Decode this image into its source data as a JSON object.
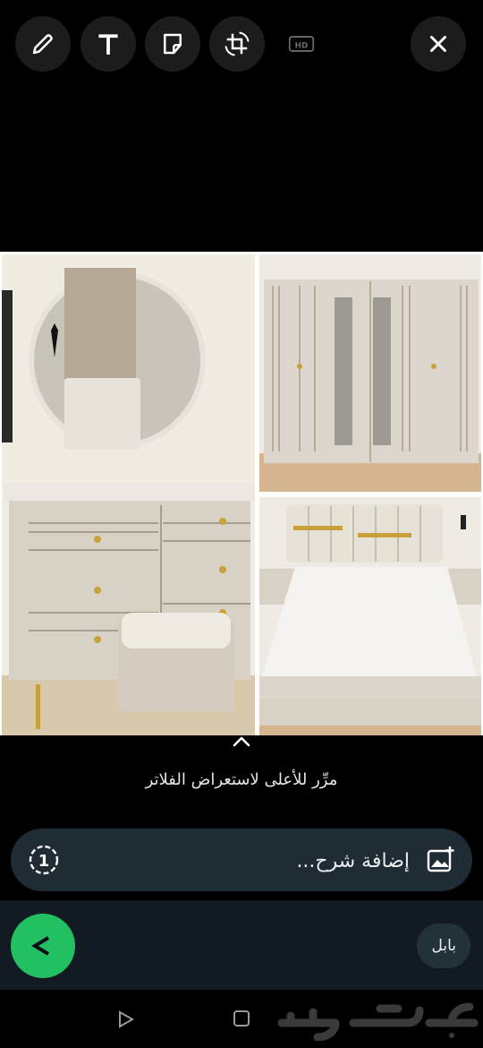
{
  "toolbar": {
    "icons": [
      "pencil-icon",
      "text-icon",
      "sticker-icon",
      "crop-rotate-icon",
      "hd-icon",
      "close-icon"
    ],
    "hd_label": "HD"
  },
  "hint": {
    "text": "مرِّر للأعلى لاستعراض الفلاتر"
  },
  "caption": {
    "placeholder": "إضافة شرح..."
  },
  "recipient": {
    "label": "بابل"
  },
  "watermark": {
    "text": "حراج"
  },
  "colors": {
    "accent": "#21c063",
    "caption_bar": "#1f2c34",
    "recipient_bar": "#121b22"
  }
}
